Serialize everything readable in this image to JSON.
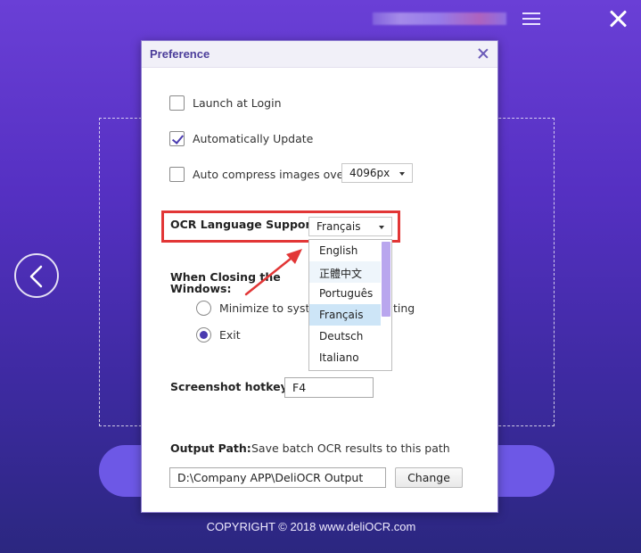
{
  "background": {
    "copyright": "COPYRIGHT © 2018   www.deliOCR.com",
    "icons": [
      "menu-icon",
      "close-icon",
      "back-arrow-icon"
    ]
  },
  "dialog": {
    "title": "Preference",
    "launch_at_login": {
      "label": "Launch at Login",
      "checked": false
    },
    "auto_update": {
      "label": "Automatically Update",
      "checked": true
    },
    "auto_compress": {
      "label": "Auto compress images over",
      "checked": false,
      "value": "4096px"
    },
    "ocr_language": {
      "label": "OCR Language Support:",
      "value": "Français",
      "options": [
        "English",
        "正體中文",
        "Português",
        "Français",
        "Deutsch",
        "Italiano"
      ],
      "selected_index": 3
    },
    "closing": {
      "label_line1": "When Closing the",
      "label_line2": "Windows:",
      "option_minimize": "Minimize to system",
      "option_minimize_suffix": "ting",
      "option_exit": "Exit",
      "selected": "Exit"
    },
    "hotkey": {
      "label": "Screenshot hotkey:",
      "value": "F4"
    },
    "output": {
      "label": "Output Path:",
      "hint": "Save batch OCR results to this path",
      "path": "D:\\Company APP\\DeliOCR Output",
      "change_label": "Change"
    }
  },
  "colors": {
    "accent": "#4b3d9a",
    "highlight_red": "#e23636",
    "background_top": "#6a3fd6",
    "background_bottom": "#2b2780",
    "selected_item": "#cde5f7"
  }
}
